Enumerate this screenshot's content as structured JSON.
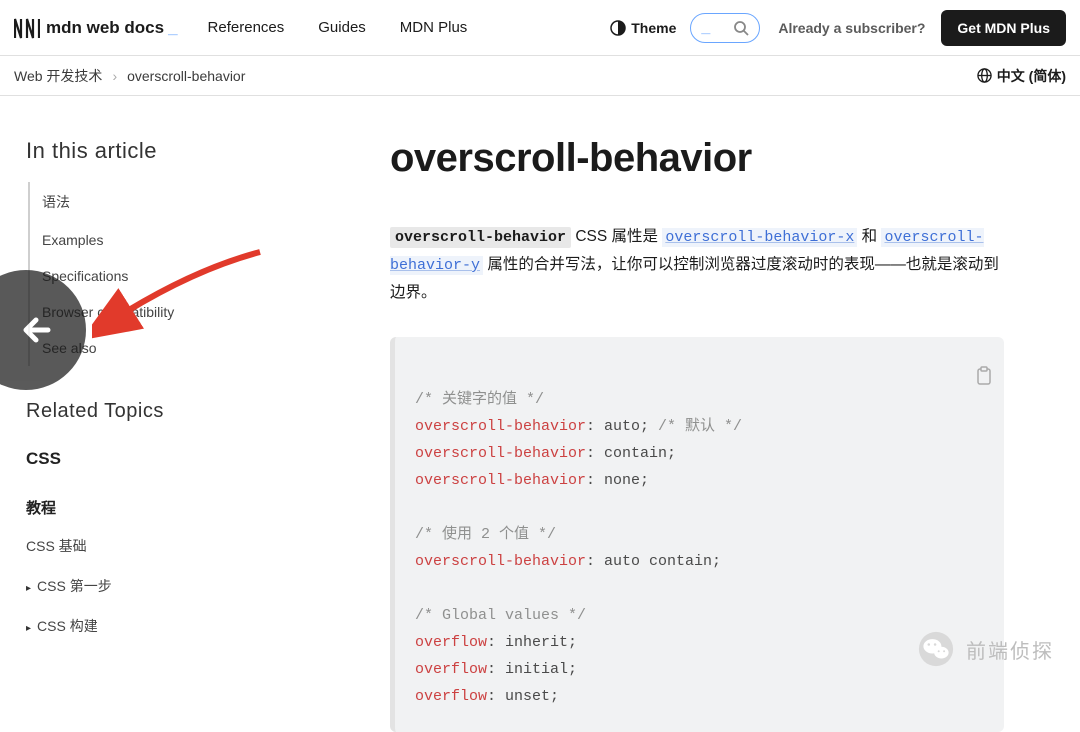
{
  "header": {
    "logo_text": "mdn web docs",
    "nav": {
      "references": "References",
      "guides": "Guides",
      "mdnplus": "MDN Plus"
    },
    "theme_label": "Theme",
    "subscriber_text": "Already a subscriber?",
    "get_plus": "Get MDN Plus"
  },
  "breadcrumb": {
    "root": "Web 开发技术",
    "sep": "›",
    "current": "overscroll-behavior"
  },
  "lang": "中文 (简体)",
  "sidebar": {
    "toc_title": "In this article",
    "toc": [
      "语法",
      "Examples",
      "Specifications",
      "Browser compatibility",
      "See also"
    ],
    "related_title": "Related Topics",
    "css_label": "CSS",
    "tutorial_label": "教程",
    "links": {
      "basics": "CSS 基础",
      "first": "CSS 第一步",
      "build": "CSS 构建"
    }
  },
  "article": {
    "title": "overscroll-behavior",
    "prop_name": "overscroll-behavior",
    "text_1": " CSS 属性是 ",
    "link_x": "overscroll-behavior-x",
    "text_2": " 和 ",
    "link_y": "overscroll-behavior-y",
    "text_3": " 属性的合并写法，让你可以控制浏览器过度滚动时的表现——也就是滚动到边界。"
  },
  "code": {
    "c1": "/* 关键字的值 */",
    "l1a": "overscroll-behavior",
    "l1b": ": auto; ",
    "l1c": "/* 默认 */",
    "l2a": "overscroll-behavior",
    "l2b": ": contain;",
    "l3a": "overscroll-behavior",
    "l3b": ": none;",
    "c2": "/* 使用 2 个值 */",
    "l4a": "overscroll-behavior",
    "l4b": ": auto contain;",
    "c3": "/* Global values */",
    "l5a": "overflow",
    "l5b": ": inherit;",
    "l6a": "overflow",
    "l6b": ": initial;",
    "l7a": "overflow",
    "l7b": ": unset;"
  },
  "watermark": "前端侦探"
}
